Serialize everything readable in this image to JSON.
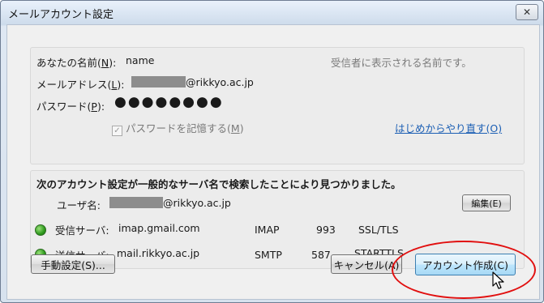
{
  "window": {
    "title": "メールアカウント設定",
    "close_glyph": "✕"
  },
  "identity": {
    "name_label": "あなたの名前(",
    "name_key": "N",
    "name_label_end": "):",
    "name_value": "name",
    "name_hint": "受信者に表示される名前です。",
    "email_label": "メールアドレス(",
    "email_key": "L",
    "email_label_end": "):",
    "email_domain": "@rikkyo.ac.jp",
    "password_label": "パスワード(",
    "password_key": "P",
    "password_label_end": "):",
    "password_value": "●●●●●●●●",
    "remember_label": "パスワードを記憶する(",
    "remember_key": "M",
    "remember_label_end": ")",
    "remember_checked": true,
    "restart_link": "はじめからやり直す(O)"
  },
  "detected": {
    "message": "次のアカウント設定が一般的なサーバ名で検索したことにより見つかりました。",
    "username_label": "ユーザ名:",
    "username_domain": "@rikkyo.ac.jp",
    "edit_button": "編集(E)",
    "incoming": {
      "label": "受信サーバ:",
      "host": "imap.gmail.com",
      "protocol": "IMAP",
      "port": "993",
      "security": "SSL/TLS",
      "status_color": "#3cab2a"
    },
    "outgoing": {
      "label": "送信サーバ:",
      "host": "mail.rikkyo.ac.jp",
      "protocol": "SMTP",
      "port": "587",
      "security": "STARTTLS",
      "status_color": "#3cab2a"
    }
  },
  "buttons": {
    "manual": "手動設定(S)...",
    "cancel": "キャンセル(A)",
    "create": "アカウント作成(C)"
  },
  "annotation_color": "#e10f0f"
}
